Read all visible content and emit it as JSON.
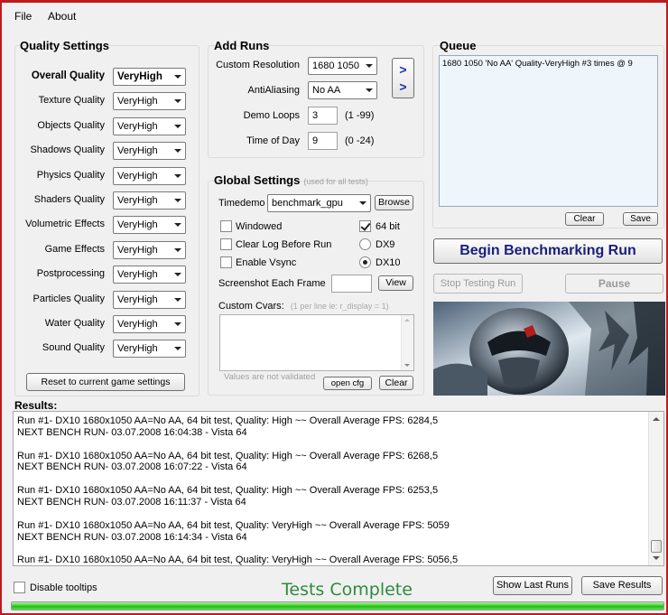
{
  "menu": {
    "file": "File",
    "about": "About"
  },
  "quality": {
    "title": "Quality Settings",
    "overall": {
      "label": "Overall Quality",
      "value": "VeryHigh"
    },
    "items": [
      {
        "label": "Texture Quality",
        "value": "VeryHigh"
      },
      {
        "label": "Objects Quality",
        "value": "VeryHigh"
      },
      {
        "label": "Shadows Quality",
        "value": "VeryHigh"
      },
      {
        "label": "Physics Quality",
        "value": "VeryHigh"
      },
      {
        "label": "Shaders Quality",
        "value": "VeryHigh"
      },
      {
        "label": "Volumetric Effects",
        "value": "VeryHigh"
      },
      {
        "label": "Game Effects",
        "value": "VeryHigh"
      },
      {
        "label": "Postprocessing",
        "value": "VeryHigh"
      },
      {
        "label": "Particles Quality",
        "value": "VeryHigh"
      },
      {
        "label": "Water Quality",
        "value": "VeryHigh"
      },
      {
        "label": "Sound Quality",
        "value": "VeryHigh"
      }
    ],
    "reset_label": "Reset to current game settings"
  },
  "add_runs": {
    "title": "Add Runs",
    "resolution": {
      "label": "Custom Resolution",
      "value": "1680 1050"
    },
    "antialiasing": {
      "label": "AntiAliasing",
      "value": "No AA"
    },
    "demo_loops": {
      "label": "Demo Loops",
      "value": "3",
      "hint": "(1 -99)"
    },
    "time_of_day": {
      "label": "Time of Day",
      "value": "9",
      "hint": "(0 -24)"
    },
    "add_arrow": "> >"
  },
  "global": {
    "title": "Global Settings",
    "subtitle": "(used for all tests)",
    "timedemo": {
      "label": "Timedemo",
      "value": "benchmark_gpu",
      "browse": "Browse"
    },
    "windowed": {
      "label": "Windowed",
      "checked": false
    },
    "clear_log": {
      "label": "Clear Log Before Run",
      "checked": false
    },
    "vsync": {
      "label": "Enable Vsync",
      "checked": false
    },
    "bit64": {
      "label": "64 bit",
      "checked": true
    },
    "dx9": {
      "label": "DX9",
      "selected": false
    },
    "dx10": {
      "label": "DX10",
      "selected": true
    },
    "screenshot": {
      "label": "Screenshot Each Frame",
      "value": "",
      "view": "View"
    },
    "cvars": {
      "label": "Custom Cvars:",
      "hint": "(1 per line ie: r_display = 1)",
      "note": "Values are not validated",
      "open_label": "open cfg",
      "clear_label": "Clear"
    }
  },
  "queue": {
    "title": "Queue",
    "items": [
      "1680 1050 'No AA' Quality-VeryHigh #3 times @ 9"
    ],
    "clear_label": "Clear",
    "save_label": "Save"
  },
  "actions": {
    "begin_label": "Begin Benchmarking Run",
    "stop_label": "Stop Testing Run",
    "pause_label": "Pause"
  },
  "results": {
    "title": "Results:",
    "lines": [
      "Run #1- DX10 1680x1050 AA=No AA, 64 bit test, Quality: High ~~ Overall Average FPS: 6284,5",
      "NEXT BENCH RUN- 03.07.2008 16:04:38 - Vista 64",
      "",
      "Run #1- DX10 1680x1050 AA=No AA, 64 bit test, Quality: High ~~ Overall Average FPS: 6268,5",
      "NEXT BENCH RUN- 03.07.2008 16:07:22 - Vista 64",
      "",
      "Run #1- DX10 1680x1050 AA=No AA, 64 bit test, Quality: High ~~ Overall Average FPS: 6253,5",
      "NEXT BENCH RUN- 03.07.2008 16:11:37 - Vista 64",
      "",
      "Run #1- DX10 1680x1050 AA=No AA, 64 bit test, Quality: VeryHigh ~~ Overall Average FPS: 5059",
      "NEXT BENCH RUN- 03.07.2008 16:14:34 - Vista 64",
      "",
      "Run #1- DX10 1680x1050 AA=No AA, 64 bit test, Quality: VeryHigh ~~ Overall Average FPS: 5056,5"
    ]
  },
  "footer": {
    "disable_tooltips": {
      "label": "Disable tooltips",
      "checked": false
    },
    "status": "Tests Complete",
    "show_last_label": "Show Last Runs",
    "save_results_label": "Save Results",
    "progress_percent": 100
  },
  "colors": {
    "accent_blue": "#1a1f7a",
    "status_green": "#2e8b3e",
    "progress_green": "#22b814",
    "frame_red": "#c0191c"
  },
  "icons": {
    "combo_arrow": "chevron-down-icon",
    "check": "checkmark-icon"
  }
}
